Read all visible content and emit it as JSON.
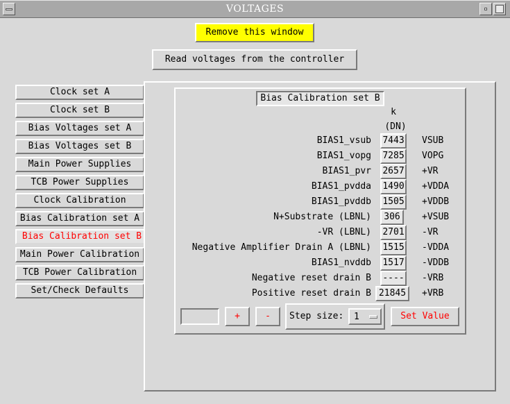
{
  "window": {
    "title": "VOLTAGES"
  },
  "toolbar": {
    "remove_label": "Remove this window",
    "read_label": "Read voltages from the controller"
  },
  "nav": {
    "items": [
      {
        "label": "Clock set A"
      },
      {
        "label": "Clock set B"
      },
      {
        "label": "Bias Voltages set A"
      },
      {
        "label": "Bias Voltages set B"
      },
      {
        "label": "Main Power Supplies"
      },
      {
        "label": "TCB Power Supplies"
      },
      {
        "label": "Clock Calibration"
      },
      {
        "label": "Bias Calibration set A"
      },
      {
        "label": "Bias Calibration set B"
      },
      {
        "label": "Main Power Calibration"
      },
      {
        "label": "TCB Power Calibration"
      },
      {
        "label": "Set/Check Defaults"
      }
    ],
    "selected": "Bias Calibration set B"
  },
  "panel": {
    "title": "Bias Calibration set B",
    "col_header": "k",
    "unit_header": "(DN)",
    "rows": [
      {
        "label": "BIAS1_vsub",
        "value": "7443",
        "signal": "VSUB"
      },
      {
        "label": "BIAS1_vopg",
        "value": "7285",
        "signal": "VOPG"
      },
      {
        "label": "BIAS1_pvr",
        "value": "2657",
        "signal": "+VR"
      },
      {
        "label": "BIAS1_pvdda",
        "value": "1490",
        "signal": "+VDDA"
      },
      {
        "label": "BIAS1_pvddb",
        "value": "1505",
        "signal": "+VDDB"
      },
      {
        "label": "N+Substrate (LBNL)",
        "value": "306",
        "signal": "+VSUB"
      },
      {
        "label": "-VR (LBNL)",
        "value": "2701",
        "signal": "-VR"
      },
      {
        "label": "Negative Amplifier Drain A (LBNL)",
        "value": "1515",
        "signal": "-VDDA"
      },
      {
        "label": "BIAS1_nvddb",
        "value": "1517",
        "signal": "-VDDB"
      },
      {
        "label": "Negative reset drain B",
        "value": "----",
        "signal": "-VRB"
      },
      {
        "label": "Positive reset drain B",
        "value": "21845",
        "signal": "+VRB"
      }
    ]
  },
  "controls": {
    "input_value": "",
    "plus_label": "+",
    "minus_label": "-",
    "step_label": "Step size:",
    "step_value": "1",
    "set_label": "Set Value"
  },
  "colors": {
    "remove_bg": "#ffff00",
    "accent_red": "#ff0000",
    "window_bg": "#d9d9d9"
  }
}
